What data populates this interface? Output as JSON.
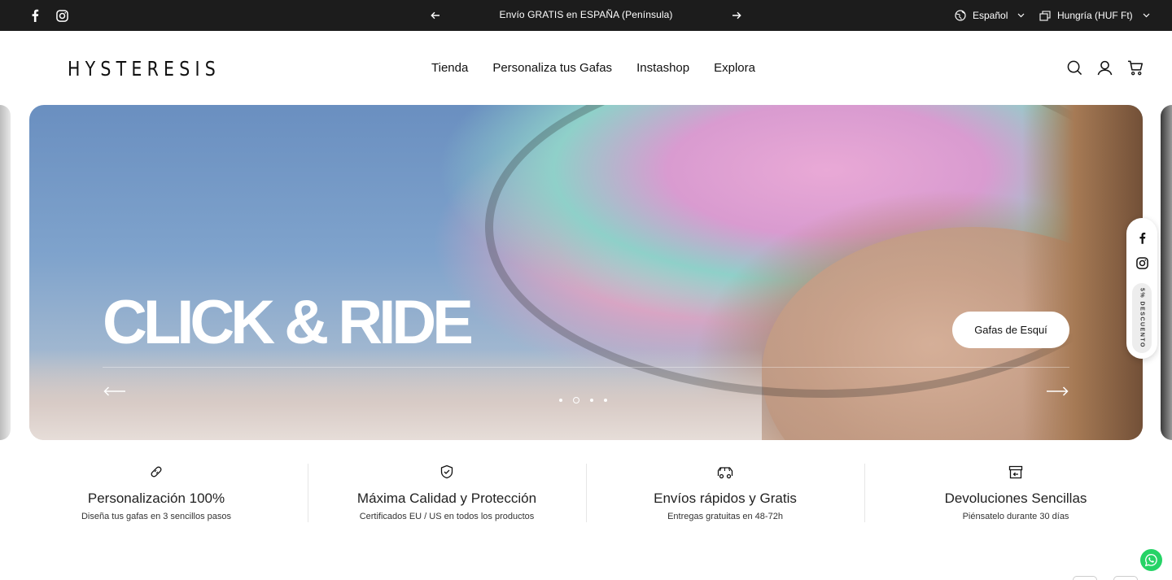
{
  "topbar": {
    "announcement": "Envío GRATIS en ESPAÑA (Península)",
    "language": "Español",
    "currency": "Hungría (HUF Ft)",
    "icons": [
      "facebook-icon",
      "instagram-icon",
      "arrow-left-icon",
      "arrow-right-icon",
      "globe-icon",
      "currency-icon",
      "chevron-down-icon"
    ]
  },
  "header": {
    "logo": "HYSTERESIS",
    "nav": [
      "Tienda",
      "Personaliza tus Gafas",
      "Instashop",
      "Explora"
    ],
    "icons": [
      "search-icon",
      "account-icon",
      "cart-icon"
    ]
  },
  "hero": {
    "headline": "CLICK & RIDE",
    "cta": "Gafas de Esquí",
    "slides_total": 4,
    "active_slide": 2
  },
  "float_social": {
    "discount": "5% DESCUENTO",
    "icons": [
      "facebook-icon",
      "instagram-icon"
    ]
  },
  "features": [
    {
      "icon": "bandage-icon",
      "title": "Personalización 100%",
      "subtitle": "Diseña tus gafas en 3 sencillos pasos"
    },
    {
      "icon": "shield-check-icon",
      "title": "Máxima Calidad y Protección",
      "subtitle": "Certificados EU / US en todos los productos"
    },
    {
      "icon": "delivery-truck-icon",
      "title": "Envíos rápidos y Gratis",
      "subtitle": "Entregas gratuitas en 48-72h"
    },
    {
      "icon": "return-box-icon",
      "title": "Devoluciones Sencillas",
      "subtitle": "Piénsatelo durante 30 días"
    }
  ],
  "colors": {
    "topbar_bg": "#1c1c1c",
    "whatsapp": "#25d366"
  }
}
